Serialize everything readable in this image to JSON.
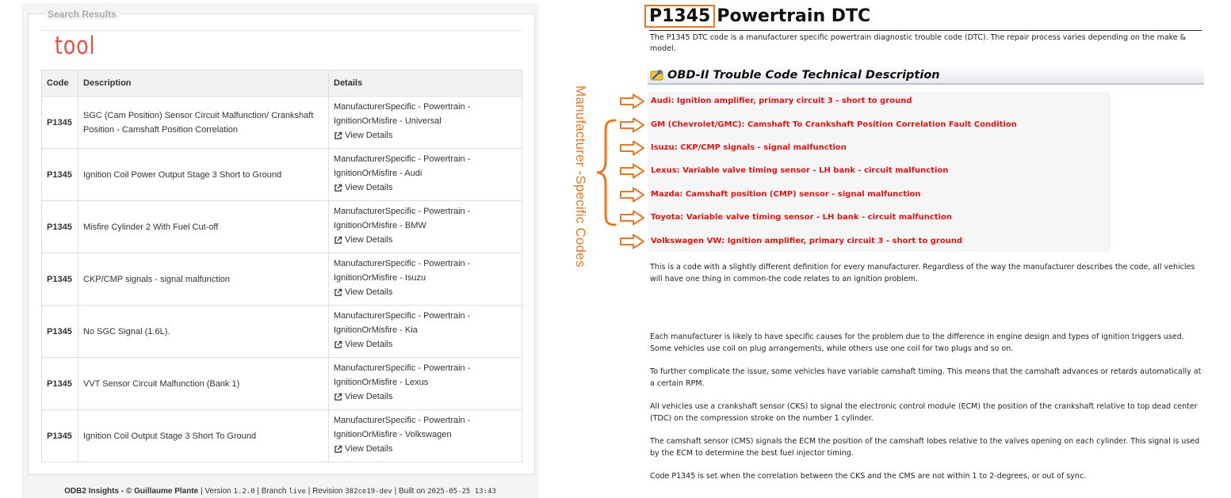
{
  "left": {
    "legend": "Search Results",
    "query": "tool",
    "table": {
      "headers": [
        "Code",
        "Description",
        "Details"
      ],
      "rows": [
        {
          "code": "P1345",
          "description": "SGC (Cam Position) Sensor Circuit Malfunction/ Crankshaft Position - Camshaft Position Correlation",
          "details_1": "ManufacturerSpecific - Powertrain -",
          "details_2": "IgnitionOrMisfire - Universal",
          "link": "View Details"
        },
        {
          "code": "P1345",
          "description": "Ignition Coil Power Output Stage 3 Short to Ground",
          "details_1": "ManufacturerSpecific - Powertrain -",
          "details_2": "IgnitionOrMisfire - Audi",
          "link": "View Details"
        },
        {
          "code": "P1345",
          "description": "Misfire Cylinder 2 With Fuel Cut-off",
          "details_1": "ManufacturerSpecific - Powertrain -",
          "details_2": "IgnitionOrMisfire - BMW",
          "link": "View Details"
        },
        {
          "code": "P1345",
          "description": "CKP/CMP signals - signal malfunction",
          "details_1": "ManufacturerSpecific - Powertrain -",
          "details_2": "IgnitionOrMisfire - Isuzu",
          "link": "View Details"
        },
        {
          "code": "P1345",
          "description": "No SGC Signal (1.6L).",
          "details_1": "ManufacturerSpecific - Powertrain -",
          "details_2": "IgnitionOrMisfire - Kia",
          "link": "View Details"
        },
        {
          "code": "P1345",
          "description": "VVT Sensor Circuit Malfunction (Bank 1)",
          "details_1": "ManufacturerSpecific - Powertrain -",
          "details_2": "IgnitionOrMisfire - Lexus",
          "link": "View Details"
        },
        {
          "code": "P1345",
          "description": "Ignition Coil Output Stage 3 Short To Ground",
          "details_1": "ManufacturerSpecific - Powertrain -",
          "details_2": "IgnitionOrMisfire - Volkswagen",
          "link": "View Details"
        }
      ]
    },
    "footer": {
      "app": "ODB2 Insights",
      "author": "- © Guillaume Plante",
      "version_label": "| Version",
      "version": "1.2.0",
      "branch_label": "| Branch",
      "branch": "live",
      "revision_label": "| Revision",
      "revision": "382ce19-dev",
      "built_label": "| Built on",
      "built": "2025-05-25 13:43"
    }
  },
  "right": {
    "code": "P1345",
    "title_rest": "Powertrain DTC",
    "intro": "The P1345 DTC code is a manufacturer specific powertrain diagnostic trouble code (DTC). The repair process varies depending on the make & model.",
    "tech_title": "OBD-II Trouble Code Technical Description",
    "annotation": "Manufacturer -Specific Codes",
    "manufacturers": [
      "Audi: Ignition amplifier, primary circuit 3 - short to ground",
      "GM (Chevrolet/GMC): Camshaft To Crankshaft Position Correlation Fault Condition",
      "Isuzu: CKP/CMP signals - signal malfunction",
      "Lexus: Variable valve timing sensor - LH bank - circuit malfunction",
      "Mazda: Camshaft position (CMP) sensor - signal malfunction",
      "Toyota: Variable valve timing sensor - LH bank - circuit malfunction",
      "Volkswagen VW: Ignition amplifier, primary circuit 3 - short to ground"
    ],
    "paragraphs": [
      "This is a code with a slightly different definition for every manufacturer. Regardless of the way the manufacturer describes the code, all vehicles will have one thing in common-the code relates to an ignition problem.",
      "Each manufacturer is likely to have specific causes for the problem due to the difference in engine design and types of ignition triggers used. Some vehicles use coil on plug arrangements, while others use one coil for two plugs and so on.",
      "To further complicate the issue, some vehicles have variable camshaft timing. This means that the camshaft advances or retards automatically at a certain RPM.",
      "All vehicles use a crankshaft sensor (CKS) to signal the electronic control module (ECM) the position of the crankshaft relative to top dead center (TDC) on the compression stroke on the number 1 cylinder.",
      "The camshaft sensor (CMS) signals the ECM the position of the camshaft lobes relative to the valves opening on each cylinder. This signal is used by the ECM to determine the best fuel injector timing.",
      "Code P1345 is set when the correlation between the CKS and the CMS are not within 1 to 2-degrees, or out of sync."
    ]
  },
  "colors": {
    "accent_orange": "#e87722",
    "query_red": "#e0524b",
    "mfr_red": "#e01616"
  }
}
